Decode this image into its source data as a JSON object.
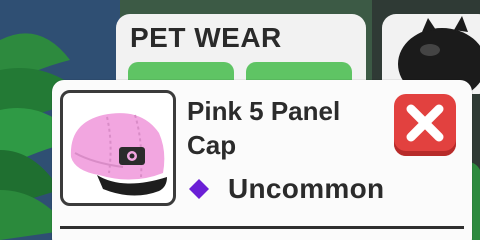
{
  "background_panel": {
    "title": "PET WEAR"
  },
  "item_card": {
    "name": "Pink 5 Panel Cap",
    "rarity": "Uncommon",
    "rarity_color": "#6b1fd6",
    "close_icon": "close-x-icon",
    "accent_close": "#e2413f"
  }
}
